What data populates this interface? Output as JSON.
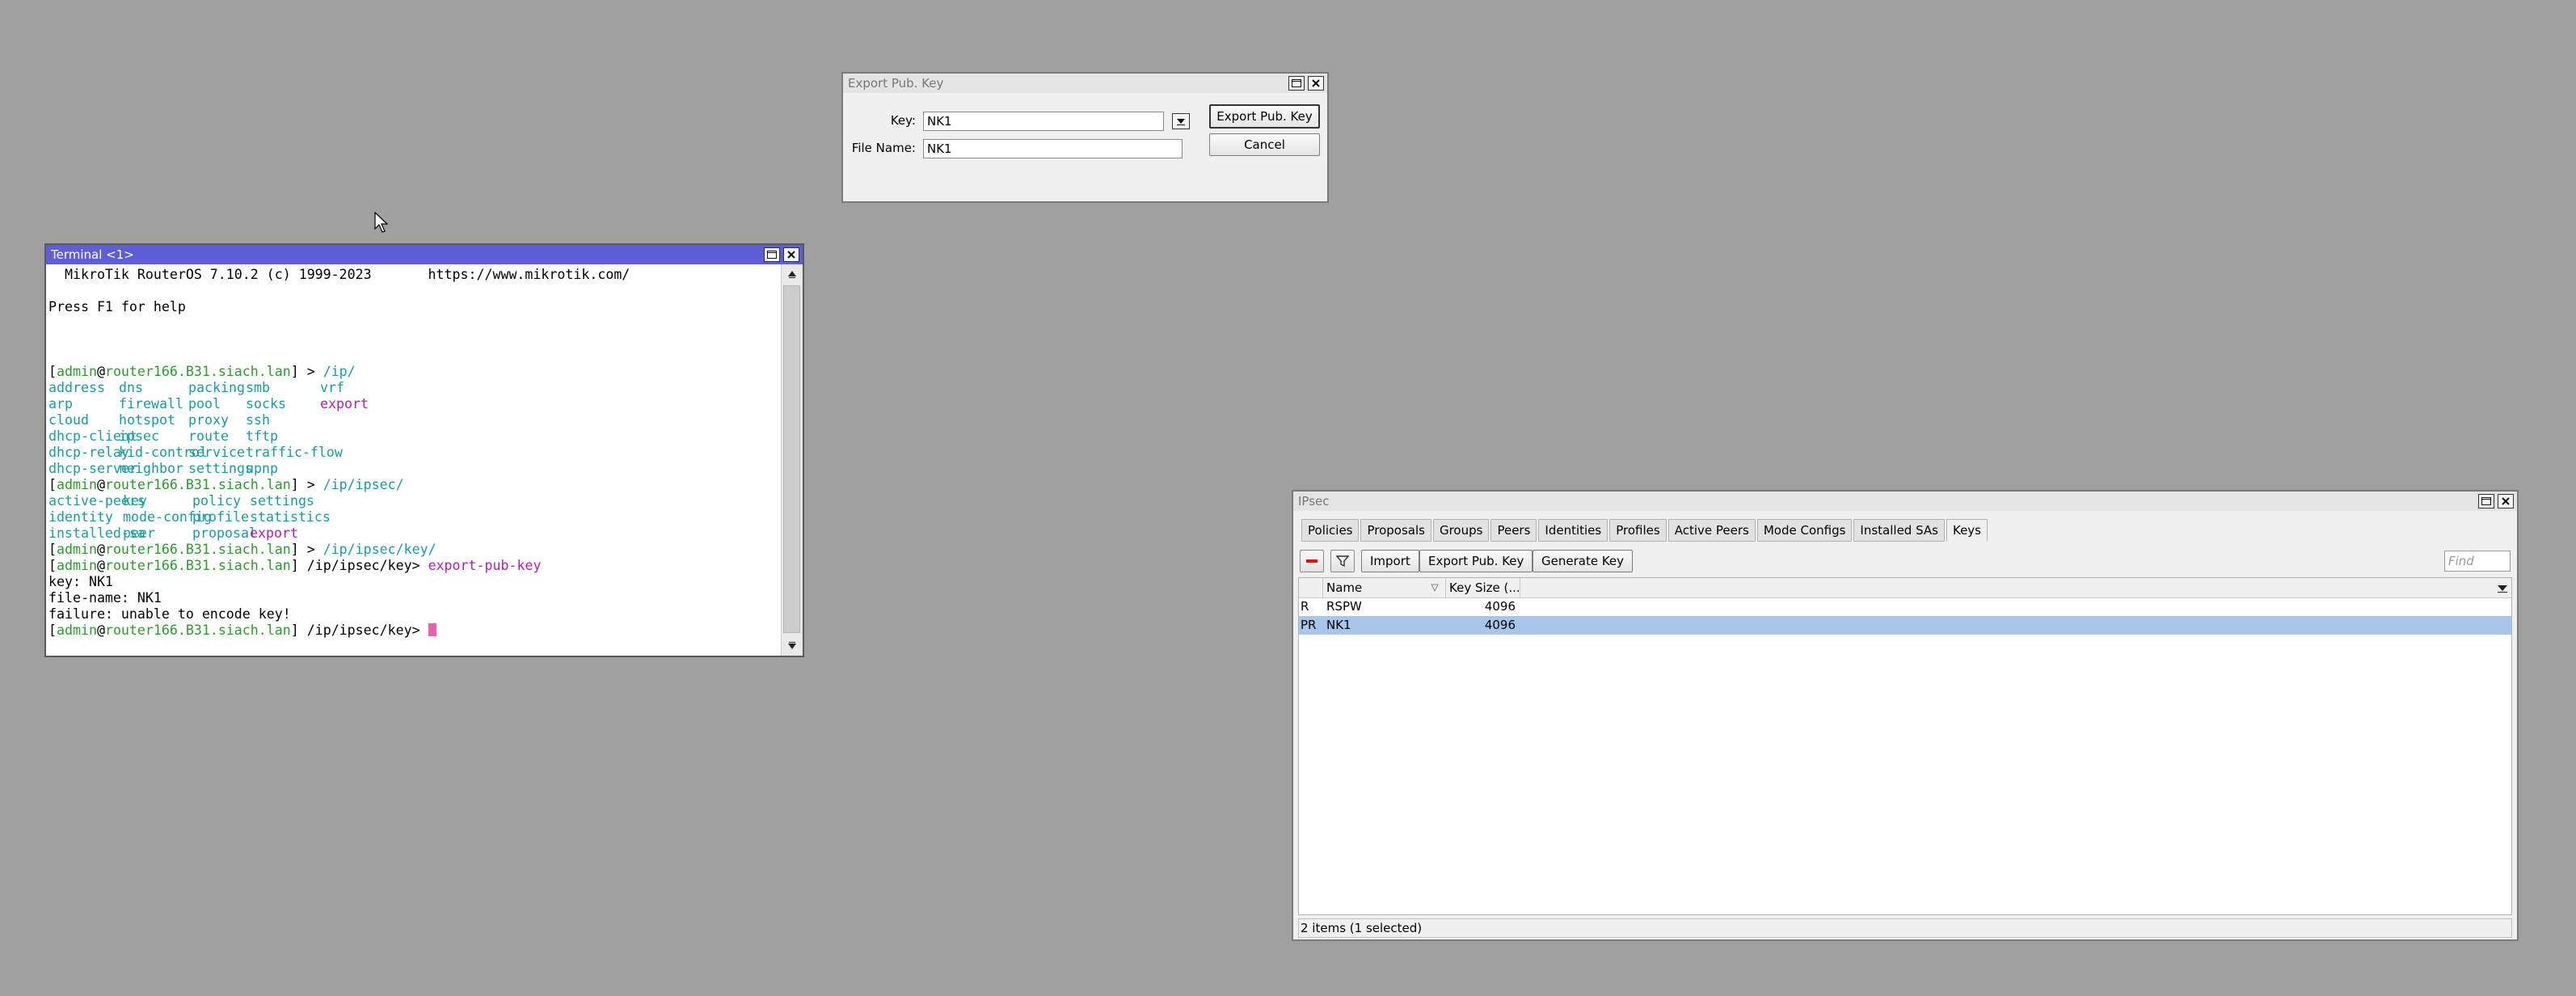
{
  "export_dialog": {
    "title": "Export Pub. Key",
    "key_label": "Key:",
    "key_value": "NK1",
    "file_label": "File Name:",
    "file_value": "NK1",
    "export_button": "Export Pub. Key",
    "cancel_button": "Cancel"
  },
  "terminal": {
    "title": "Terminal <1>",
    "banner": "  MikroTik RouterOS 7.10.2 (c) 1999-2023       https://www.mikrotik.com/",
    "help": "Press F1 for help",
    "prompt": {
      "user": "admin",
      "host": "router166.B31.siach.lan"
    },
    "cmd1": "/ip/",
    "ip_menu": [
      [
        "address",
        "dns",
        "packing",
        "smb",
        "vrf"
      ],
      [
        "arp",
        "firewall",
        "pool",
        "socks",
        "export"
      ],
      [
        "cloud",
        "hotspot",
        "proxy",
        "ssh",
        ""
      ],
      [
        "dhcp-client",
        "ipsec",
        "route",
        "tftp",
        ""
      ],
      [
        "dhcp-relay",
        "kid-control",
        "service",
        "traffic-flow",
        ""
      ],
      [
        "dhcp-server",
        "neighbor",
        "settings",
        "upnp",
        ""
      ]
    ],
    "cmd2": "/ip/ipsec/",
    "ipsec_menu": [
      [
        "active-peers",
        "key",
        "policy",
        "settings"
      ],
      [
        "identity",
        "mode-config",
        "profile",
        "statistics"
      ],
      [
        "installed-sa",
        "peer",
        "proposal",
        "export"
      ]
    ],
    "cmd3": "/ip/ipsec/key/",
    "path4": "/ip/ipsec/key",
    "cmd4": "export-pub-key",
    "out1": "key: NK1",
    "out2": "file-name: NK1",
    "out3": "failure: unable to encode key!",
    "path5": "/ip/ipsec/key"
  },
  "ipsec": {
    "title": "IPsec",
    "tabs": [
      "Policies",
      "Proposals",
      "Groups",
      "Peers",
      "Identities",
      "Profiles",
      "Active Peers",
      "Mode Configs",
      "Installed SAs",
      "Keys"
    ],
    "active_tab": "Keys",
    "toolbar": {
      "import": "Import",
      "export_pub_key": "Export Pub. Key",
      "generate_key": "Generate Key",
      "find_placeholder": "Find"
    },
    "columns": [
      "Name",
      "Key Size (..."
    ],
    "rows": [
      {
        "flags": "R",
        "name": "RSPW",
        "key_size": "4096"
      },
      {
        "flags": "PR",
        "name": "NK1",
        "key_size": "4096"
      }
    ],
    "status": "2 items (1 selected)"
  }
}
